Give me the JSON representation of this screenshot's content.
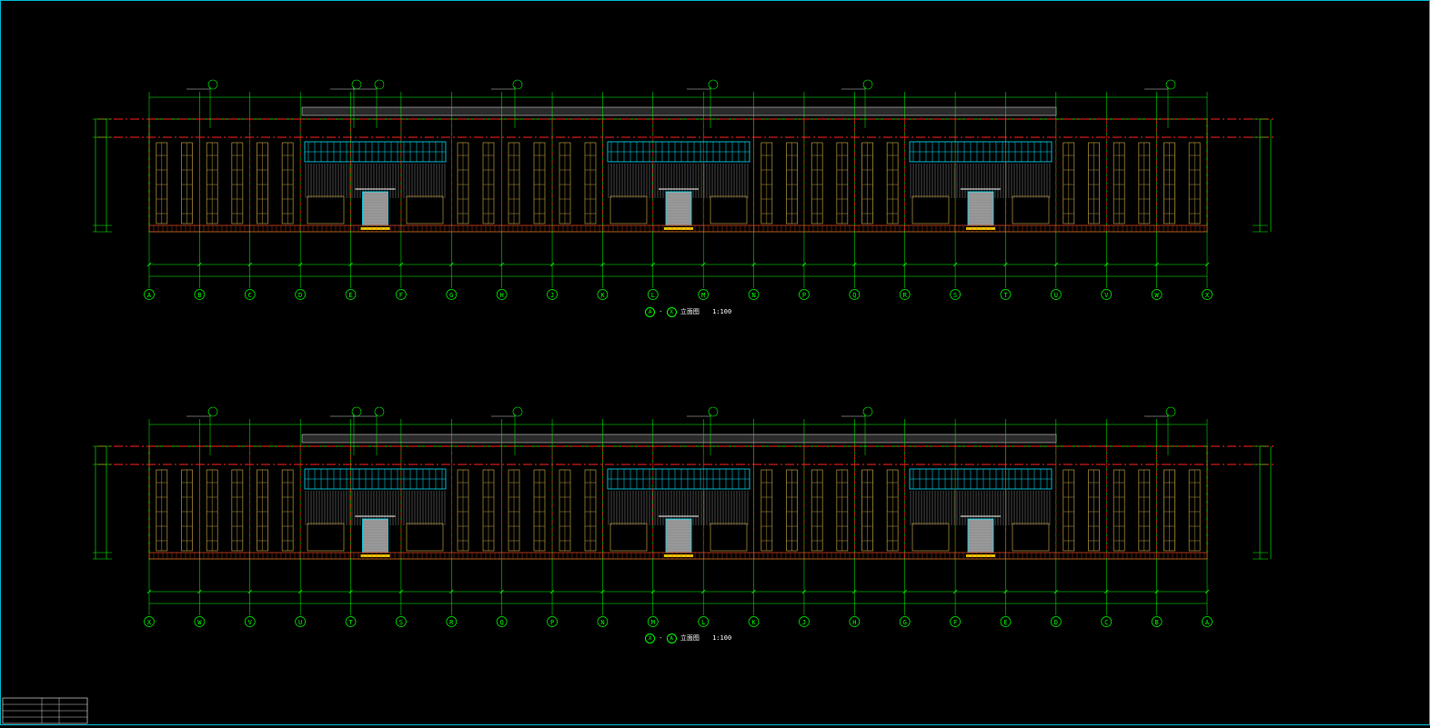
{
  "drawing": {
    "colors": {
      "background": "#000000",
      "dim": "#00ff00",
      "axis_line": "#ff2020",
      "window": "#b89a3c",
      "glazing": "#00e5ff",
      "wall_panel": "#cfcfcf",
      "brick": "#d8421e",
      "door": "#9a9a9a",
      "text": "#ffffff",
      "frame": "#00bcd4"
    },
    "elevations": [
      {
        "id": "elevation-a-x",
        "caption_from": "A",
        "caption_to": "X",
        "caption_suffix": "立面图",
        "scale": "1:100",
        "axes": [
          "A",
          "B",
          "C",
          "D",
          "E",
          "F",
          "G",
          "H",
          "J",
          "K",
          "L",
          "M",
          "N",
          "P",
          "Q",
          "R",
          "S",
          "T",
          "U",
          "V",
          "W",
          "X"
        ]
      },
      {
        "id": "elevation-x-a",
        "caption_from": "X",
        "caption_to": "A",
        "caption_suffix": "立面图",
        "scale": "1:100",
        "axes": [
          "X",
          "W",
          "V",
          "U",
          "T",
          "S",
          "R",
          "Q",
          "P",
          "N",
          "M",
          "L",
          "K",
          "J",
          "H",
          "G",
          "F",
          "E",
          "D",
          "C",
          "B",
          "A"
        ]
      }
    ],
    "titleblock_icon": "titleblock-table"
  }
}
